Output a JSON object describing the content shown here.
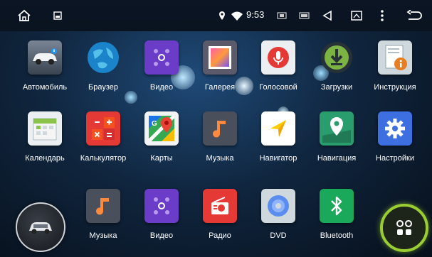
{
  "status_bar": {
    "time": "9:53",
    "icons": [
      "home-icon",
      "screenshot-icon",
      "location-icon",
      "wifi-icon",
      "usb-icon",
      "battery-icon",
      "volume-icon",
      "window-icon",
      "more-icon",
      "back-icon"
    ]
  },
  "apps_row1": [
    {
      "label": "Автомобиль",
      "icon": "car-icon"
    },
    {
      "label": "Браузер",
      "icon": "globe-icon"
    },
    {
      "label": "Видео",
      "icon": "video-icon"
    },
    {
      "label": "Галерея",
      "icon": "gallery-icon"
    },
    {
      "label": "Голосовой",
      "icon": "microphone-icon"
    },
    {
      "label": "Загрузки",
      "icon": "download-icon"
    },
    {
      "label": "Инструкция",
      "icon": "manual-icon"
    }
  ],
  "apps_row2": [
    {
      "label": "Календарь",
      "icon": "calendar-icon"
    },
    {
      "label": "Калькулятор",
      "icon": "calculator-icon"
    },
    {
      "label": "Карты",
      "icon": "maps-icon"
    },
    {
      "label": "Музыка",
      "icon": "music-icon"
    },
    {
      "label": "Навигатор",
      "icon": "navigator-icon"
    },
    {
      "label": "Навигация",
      "icon": "navigation-pin-icon"
    },
    {
      "label": "Настройки",
      "icon": "settings-gear-icon"
    }
  ],
  "dock": [
    {
      "label": "Музыка",
      "icon": "music-icon"
    },
    {
      "label": "Видео",
      "icon": "video-icon"
    },
    {
      "label": "Радио",
      "icon": "radio-icon"
    },
    {
      "label": "DVD",
      "icon": "dvd-icon"
    },
    {
      "label": "Bluetooth",
      "icon": "bluetooth-icon"
    }
  ],
  "colors": {
    "status_bar": "#0b1524",
    "dock_button_ring": "#9acd32",
    "video_tile": "#6a3cc7",
    "radio_tile": "#e53935",
    "bluetooth_tile": "#1aa85a"
  }
}
